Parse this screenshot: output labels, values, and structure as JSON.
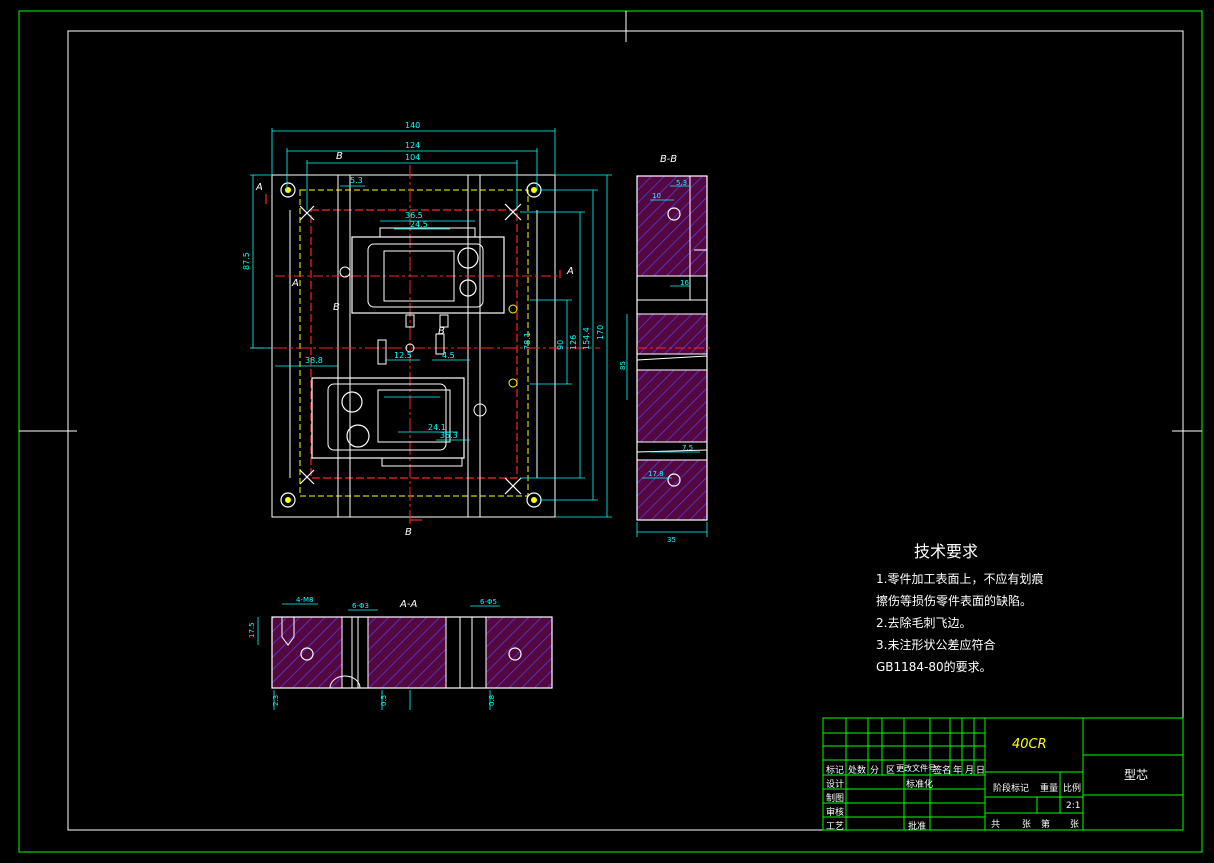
{
  "views": {
    "section_bb": "B-B",
    "section_aa": "A-A",
    "cut_a": "A",
    "cut_b": "B"
  },
  "dimensions": {
    "top": [
      "140",
      "124",
      "104"
    ],
    "right": [
      "170",
      "154.4",
      "126",
      "90",
      "78.1"
    ],
    "left": [
      "87.5",
      "38.8"
    ],
    "hole": "5.3",
    "inner": [
      "36.5",
      "24.5",
      "12.5",
      "4.5",
      "35.3",
      "24.1"
    ],
    "bb": [
      "5.3",
      "10",
      "16",
      "85",
      "7.5",
      "17.8",
      "35"
    ],
    "aa": [
      "4-M8",
      "6-Φ3",
      "6-Φ5",
      "17.5",
      "2.3",
      "0.5",
      "0.8"
    ]
  },
  "technical_requirements": {
    "title": "技术要求",
    "items": [
      "1.零件加工表面上，不应有划痕",
      "  擦伤等损伤零件表面的缺陷。",
      "2.去除毛刺飞边。",
      "3.未注形状公差应符合",
      "  GB1184-80的要求。"
    ]
  },
  "title_block": {
    "material": "40CR",
    "part_name": "型芯",
    "header_row": [
      "标记",
      "处数",
      "分",
      "区",
      "更改文件号",
      "签名",
      "年",
      "月",
      "日"
    ],
    "left_rows": [
      "设计",
      "制图",
      "审核",
      "工艺"
    ],
    "standardization": "标准化",
    "approval": "批准",
    "stage_mark": "阶段标记",
    "weight": "重量",
    "scale": "比例",
    "scale_value": "2:1",
    "sheets": [
      "共",
      "张",
      "第",
      "张"
    ]
  },
  "colors": {
    "border": "#00ff00",
    "outline": "#ffffff",
    "dimension": "#00ffff",
    "hidden": "#ffff00",
    "center": "#ff0000",
    "hatch": "#ff00ff",
    "fill": "#5a0a4a"
  }
}
